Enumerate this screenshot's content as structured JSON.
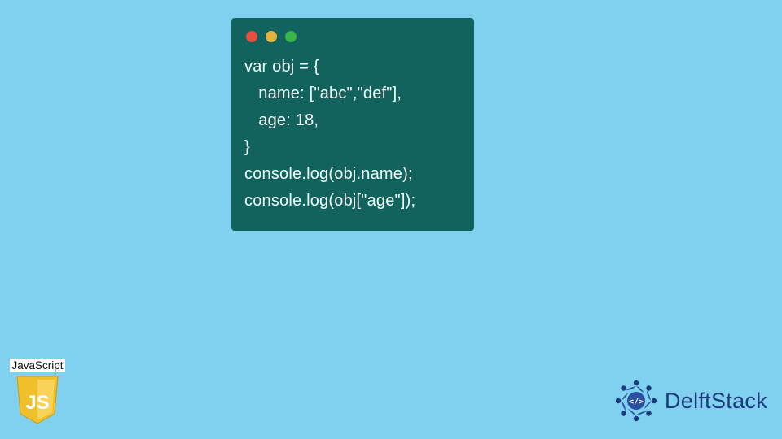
{
  "code": {
    "lines": [
      "var obj = {",
      "   name: [\"abc\",\"def\"],",
      "   age: 18,",
      "}",
      "console.log(obj.name);",
      "console.log(obj[\"age\"]);"
    ]
  },
  "js_badge": {
    "label": "JavaScript",
    "shield_text": "JS"
  },
  "brand": {
    "name": "DelftStack"
  },
  "window": {
    "dots": [
      "red",
      "yellow",
      "green"
    ]
  },
  "colors": {
    "background": "#7fd1ef",
    "window": "#12635d",
    "brand_text": "#1c3b7a",
    "js_yellow": "#f0c02a"
  }
}
